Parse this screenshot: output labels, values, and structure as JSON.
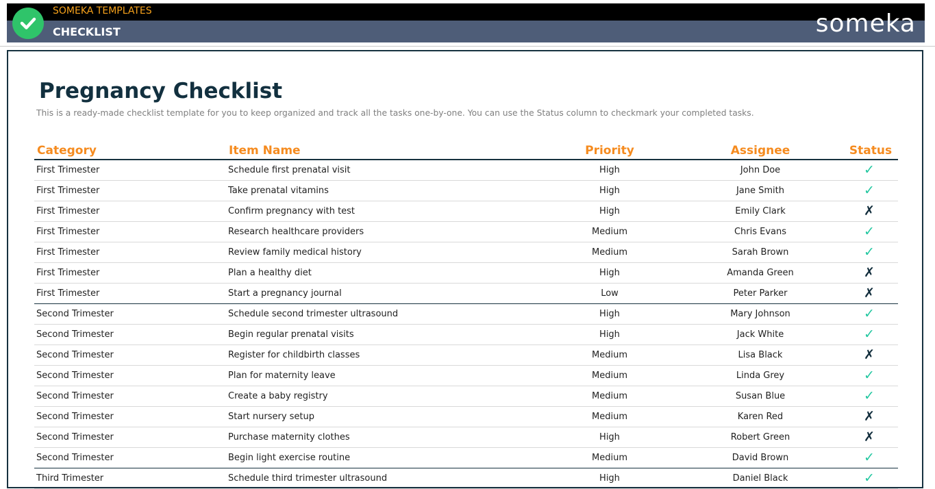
{
  "header": {
    "brand": "SOMEKA TEMPLATES",
    "app_title": "CHECKLIST",
    "wordmark": "someka",
    "logo_icon": "check-circle-icon",
    "colors": {
      "accent": "#2fc46a",
      "brand_text": "#f7a21b",
      "bar": "#4e5d78",
      "column_header": "#f58b1f"
    }
  },
  "page": {
    "title": "Pregnancy Checklist",
    "description": "This is a ready-made checklist template for you to keep organized and track all the tasks one-by-one. You can use the Status column to checkmark your completed tasks."
  },
  "table": {
    "columns": [
      "Category",
      "Item Name",
      "Priority",
      "Assignee",
      "Status"
    ],
    "rows": [
      {
        "category": "First Trimester",
        "item": "Schedule first prenatal visit",
        "priority": "High",
        "assignee": "John Doe",
        "status": "✓",
        "done": true
      },
      {
        "category": "First Trimester",
        "item": "Take prenatal vitamins",
        "priority": "High",
        "assignee": "Jane Smith",
        "status": "✓",
        "done": true
      },
      {
        "category": "First Trimester",
        "item": "Confirm pregnancy with test",
        "priority": "High",
        "assignee": "Emily Clark",
        "status": "✗",
        "done": false
      },
      {
        "category": "First Trimester",
        "item": "Research healthcare providers",
        "priority": "Medium",
        "assignee": "Chris Evans",
        "status": "✓",
        "done": true
      },
      {
        "category": "First Trimester",
        "item": "Review family medical history",
        "priority": "Medium",
        "assignee": "Sarah Brown",
        "status": "✓",
        "done": true
      },
      {
        "category": "First Trimester",
        "item": "Plan a healthy diet",
        "priority": "High",
        "assignee": "Amanda Green",
        "status": "✗",
        "done": false
      },
      {
        "category": "First Trimester",
        "item": "Start a pregnancy journal",
        "priority": "Low",
        "assignee": "Peter Parker",
        "status": "✗",
        "done": false
      },
      {
        "category": "Second Trimester",
        "item": "Schedule second trimester ultrasound",
        "priority": "High",
        "assignee": "Mary Johnson",
        "status": "✓",
        "done": true
      },
      {
        "category": "Second Trimester",
        "item": "Begin regular prenatal visits",
        "priority": "High",
        "assignee": "Jack White",
        "status": "✓",
        "done": true
      },
      {
        "category": "Second Trimester",
        "item": "Register for childbirth classes",
        "priority": "Medium",
        "assignee": "Lisa Black",
        "status": "✗",
        "done": false
      },
      {
        "category": "Second Trimester",
        "item": "Plan for maternity leave",
        "priority": "Medium",
        "assignee": "Linda Grey",
        "status": "✓",
        "done": true
      },
      {
        "category": "Second Trimester",
        "item": "Create a baby registry",
        "priority": "Medium",
        "assignee": "Susan Blue",
        "status": "✓",
        "done": true
      },
      {
        "category": "Second Trimester",
        "item": "Start nursery setup",
        "priority": "Medium",
        "assignee": "Karen Red",
        "status": "✗",
        "done": false
      },
      {
        "category": "Second Trimester",
        "item": "Purchase maternity clothes",
        "priority": "High",
        "assignee": "Robert Green",
        "status": "✗",
        "done": false
      },
      {
        "category": "Second Trimester",
        "item": "Begin light exercise routine",
        "priority": "Medium",
        "assignee": "David Brown",
        "status": "✓",
        "done": true
      },
      {
        "category": "Third Trimester",
        "item": "Schedule third trimester ultrasound",
        "priority": "High",
        "assignee": "Daniel Black",
        "status": "✓",
        "done": true
      }
    ]
  }
}
